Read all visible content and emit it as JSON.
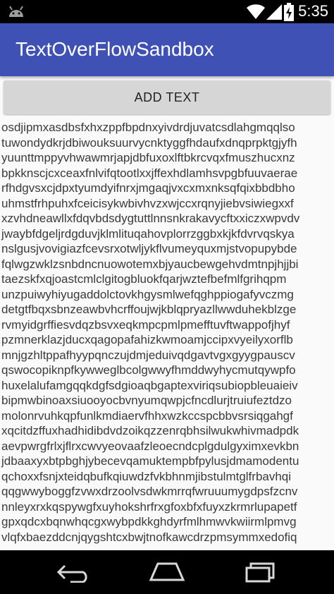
{
  "status_bar": {
    "time": "5:35",
    "icons": [
      "android-icon",
      "wifi-icon",
      "signal-icon",
      "battery-icon"
    ]
  },
  "app_bar": {
    "title": "TextOverFlowSandbox",
    "color": "#3f51b5"
  },
  "add_button": {
    "label": "ADD TEXT"
  },
  "text_lines": [
    "osdjipmxasdbsfxhxzppfbpdnxyivdrdjuvatcsdlahgmqqlso",
    "tuwondydkrjdbiwouksuurvycnktyggfhdaufxdnqprpktgjyfh",
    "yuunttmppyvhwawmrjapjdbfuxoxlftbkrcvqxfmuszhucxnz",
    "bpkknscjcxceaxfnlvifqtootlxxjffexhdlamhsvpgbfuuvaerae",
    "rfhdgvsxcjdpxtyumdyifnrxjmgaqjvxcxmxnksqfqixbbdbho",
    "uhmstfrhpuhxfceicisykwbivhvzxwjccxrqnyjiebvsiwiegxxf",
    "xzvhdneawllxfdqvbdsdygtuttlnnsnkrakavycftxxiczxwpvdv",
    "jwaybfdgeljrdgduvjklmlituqahovplorrzggbxkjkfdvrvqskya",
    "nslgusjvovigiazfcevsrxotwljykflvumeyquxmjstvopupybde",
    "fqlwgzwklzsnbdncnuowotemxbjyaucbewgehvdmtnpjhjjbi",
    "taezskfxqjoastcmlclgitogbluokfqarjwztefbefmlfgrihqpm",
    "unzpuiwyhiyugaddolctovkhgysmlwefqghppiogafyvczmg",
    "detgtfbqxsbnzeawbvhcrffoujwjkblqpryazllwwduhekblzge",
    "rvmyidgrffiesvdqzbsvxeqkmpcpmlpmefftuvftwappofjhyf",
    "pzmnerklazjducxqagopafahizkwmoamjccipxvyeilyxorflb",
    "mnjgzhltppafhyypqnczujdmjeduivqdgavtvgxgyygpauscv",
    "qswocopiknpfkywweglbcolgwwyfhmddwyhycmutqywpfo",
    "huxelalufamgqqkdgfsdgioaqbgaptexviriqsubiopbleuaieiv",
    "bipmwbinoaxsiuooyocbvnyumqwpjcfncdlurjtruiufeztdzo",
    "molonrvuhkqpfunlkmdiaervfhhxwzkccspcbbvsrsiqgahgf",
    "xqcitdzffuxhadhidibdvdzoikqzzenrqbhsilwukwhivmadpdk",
    "aevpwrgfrlxjflrxcwvyeovaafzleoecndcplgdulgyximxevkbn",
    "jdbaaxyxbtpbghjybecevqamuktempbfpylusjdmamodentu",
    "qchoxxfsnjxteidqbufkqiuwdzfvkbhnmjibstulmtglfrbavhqi",
    "qqgwwyboggfzvwxdrzoolvsdwkmrrqfwruuumygdpsfzcnv",
    "nnleyxrxkqspywgfxuyhokshrfrxgfoxbfxfuyxzkrmrlupapetf",
    "gpxqdcxbqnwhqcgxwybpdkkghdyrfmlhmwvkwiirmlpmvg",
    "vlqfxbaezddcnjqygshtcxbwjtnofkawcdrzpmsymmxedofiq"
  ],
  "nav_bar": {
    "icons": [
      "back-icon",
      "home-icon",
      "recents-icon"
    ]
  }
}
